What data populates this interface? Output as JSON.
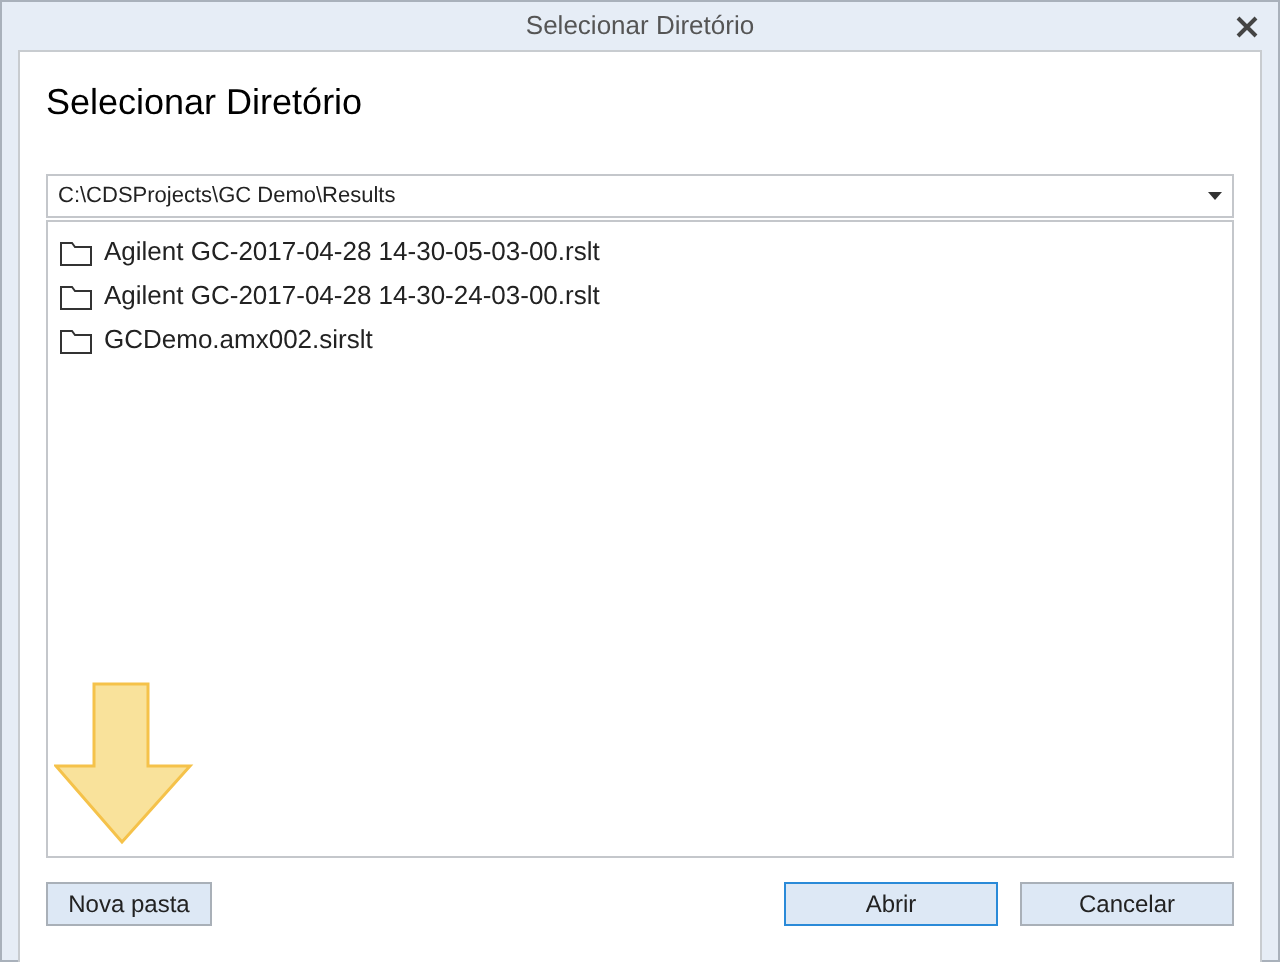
{
  "window": {
    "title": "Selecionar Diretório"
  },
  "heading": "Selecionar Diretório",
  "path_combo": {
    "value": "C:\\CDSProjects\\GC Demo\\Results"
  },
  "folders": [
    {
      "name": "Agilent GC-2017-04-28 14-30-05-03-00.rslt"
    },
    {
      "name": "Agilent GC-2017-04-28 14-30-24-03-00.rslt"
    },
    {
      "name": "GCDemo.amx002.sirslt"
    }
  ],
  "new_folder_button": "Nova pasta",
  "buttons": [
    {
      "label": "Abrir",
      "default": true
    },
    {
      "label": "Cancelar",
      "default": false
    }
  ]
}
